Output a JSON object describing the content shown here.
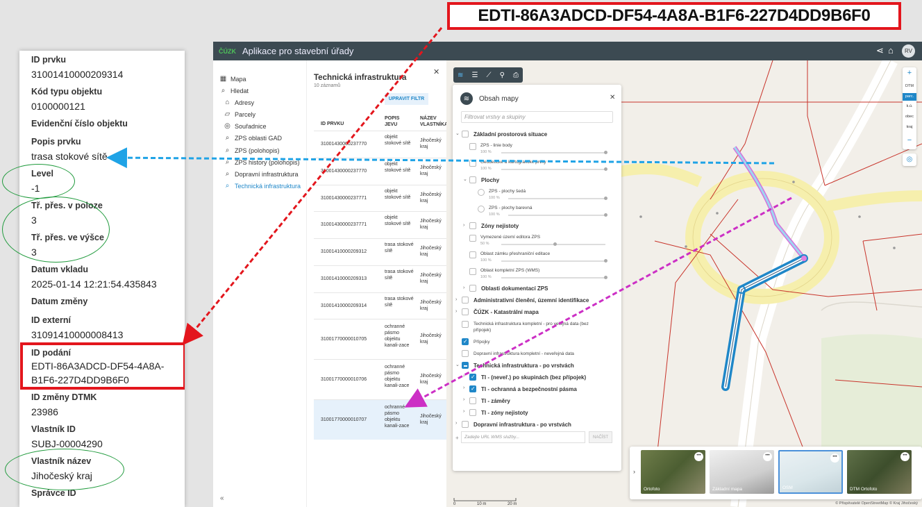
{
  "callout": {
    "id_text": "EDTI-86A3ADCD-DF54-4A8A-B1F6-227D4DD9B6F0"
  },
  "attributes": [
    {
      "label": "ID prvku",
      "value": "31001410000209314"
    },
    {
      "label": "Kód typu objektu",
      "value": "0100000121"
    },
    {
      "label": "Evidenční číslo objektu",
      "value": ""
    },
    {
      "label": "Popis prvku",
      "value": "trasa stokové sítě"
    },
    {
      "label": "Level",
      "value": "-1"
    },
    {
      "label": "Tř. přes. v poloze",
      "value": "3"
    },
    {
      "label": "Tř. přes. ve výšce",
      "value": "3"
    },
    {
      "label": "Datum vkladu",
      "value": "2025-01-14 12:21:54.435843"
    },
    {
      "label": "Datum změny",
      "value": ""
    },
    {
      "label": "ID externí",
      "value": "31091410000008413"
    },
    {
      "label": "ID podání",
      "value": "EDTI-86A3ADCD-DF54-4A8A-B1F6-227D4DD9B6F0"
    },
    {
      "label": "ID změny DTMK",
      "value": "23986"
    },
    {
      "label": "Vlastník ID",
      "value": "SUBJ-00004290"
    },
    {
      "label": "Vlastník název",
      "value": "Jihočeský kraj"
    },
    {
      "label": "Správce ID",
      "value": ""
    }
  ],
  "app": {
    "logo": "ČÚZK",
    "title": "Aplikace pro stavební úřady",
    "icons": {
      "share": "share-icon",
      "home": "home-icon"
    },
    "user_initials": "RV"
  },
  "nav": [
    {
      "label": "Mapa",
      "icon": "map-icon"
    },
    {
      "label": "Hledat",
      "icon": "search-icon"
    },
    {
      "label": "Adresy",
      "icon": "home-icon"
    },
    {
      "label": "Parcely",
      "icon": "parcel-icon"
    },
    {
      "label": "Souřadnice",
      "icon": "target-icon"
    },
    {
      "label": "ZPS oblasti GAD",
      "icon": "search-icon"
    },
    {
      "label": "ZPS (polohopis)",
      "icon": "search-icon"
    },
    {
      "label": "ZPS history (polohopis)",
      "icon": "search-icon"
    },
    {
      "label": "Dopravní infrastruktura",
      "icon": "search-icon"
    },
    {
      "label": "Technická infrastruktura",
      "icon": "search-icon"
    }
  ],
  "results": {
    "title": "Technická infrastruktura",
    "count": "10 záznamů",
    "filter_button": "UPRAVIT FILTR",
    "columns": [
      "ID PRVKU",
      "POPIS JEVU",
      "NÁZEV VLASTNÍKA"
    ],
    "rows": [
      {
        "id": "31001430000237770",
        "popis": "objekt stokové sítě",
        "vlastnik": "Jihočeský kraj"
      },
      {
        "id": "31001430000237770",
        "popis": "objekt stokové sítě",
        "vlastnik": "Jihočeský kraj"
      },
      {
        "id": "31001430000237771",
        "popis": "objekt stokové sítě",
        "vlastnik": "Jihočeský kraj"
      },
      {
        "id": "31001430000237771",
        "popis": "objekt stokové sítě",
        "vlastnik": "Jihočeský kraj"
      },
      {
        "id": "31001410000209312",
        "popis": "trasa stokové sítě",
        "vlastnik": "Jihočeský kraj"
      },
      {
        "id": "31001410000209313",
        "popis": "trasa stokové sítě",
        "vlastnik": "Jihočeský kraj"
      },
      {
        "id": "31001410000209314",
        "popis": "trasa stokové sítě",
        "vlastnik": "Jihočeský kraj"
      },
      {
        "id": "31001770000010705",
        "popis": "ochranné pásmo objektu kanali-zace",
        "vlastnik": "Jihočeský kraj"
      },
      {
        "id": "31001770000010706",
        "popis": "ochranné pásmo objektu kanali-zace",
        "vlastnik": "Jihočeský kraj"
      },
      {
        "id": "31001770000010707",
        "popis": "ochranné pásmo objektu kanali-zace",
        "vlastnik": "Jihočeský kraj"
      }
    ]
  },
  "map_toolbar": [
    "layers-icon",
    "list-icon",
    "ruler-icon",
    "pin-icon",
    "print-icon"
  ],
  "layers_panel": {
    "title": "Obsah mapy",
    "search_placeholder": "Filtrovat vrstvy a skupiny",
    "items": [
      {
        "label": "Základní prostorová situace",
        "pct": ""
      },
      {
        "label": "ZPS - linie body",
        "pct": "100 %"
      },
      {
        "label": "Geodetické a kartografické prvky",
        "pct": "100 %"
      },
      {
        "label": "Plochy",
        "pct": ""
      },
      {
        "label": "ZPS - plochy šedá",
        "pct": "100 %"
      },
      {
        "label": "ZPS - plochy barevná",
        "pct": "100 %"
      },
      {
        "label": "Zóny nejistoty",
        "pct": ""
      },
      {
        "label": "Vymezené území editora ZPS",
        "pct": "50 %"
      },
      {
        "label": "Oblast zámku přeshraniční editace",
        "pct": "100 %"
      },
      {
        "label": "Oblast kompletní ZPS (WMS)",
        "pct": "100 %"
      },
      {
        "label": "Oblasti dokumentací ZPS",
        "pct": ""
      },
      {
        "label": "Administrativní členění, územní identifikace",
        "pct": ""
      },
      {
        "label": "ČÚZK - Katastrální mapa",
        "pct": ""
      },
      {
        "label": "Technická infrastruktura kompletní - pro veřejná data (bez přípojek)",
        "pct": ""
      },
      {
        "label": "Přípojky",
        "pct": ""
      },
      {
        "label": "Dopravní infrastruktura kompletní - neveřejná data",
        "pct": ""
      },
      {
        "label": "Technická infrastruktura - po vrstvách",
        "pct": ""
      },
      {
        "label": "TI - (neveř.) po skupinách (bez přípojek)",
        "pct": ""
      },
      {
        "label": "TI - ochranná a bezpečnostní pásma",
        "pct": ""
      },
      {
        "label": "TI - záměry",
        "pct": ""
      },
      {
        "label": "TI - zóny nejistoty",
        "pct": ""
      },
      {
        "label": "Dopravní infrastruktura - po vrstvách",
        "pct": ""
      }
    ],
    "url_placeholder": "Zadejte URL WMS služby...",
    "load_button": "NAČÍST"
  },
  "zoom": {
    "plus": "+",
    "minus": "−",
    "layers": [
      "DTM",
      "parc.",
      "k.ú.",
      "obec",
      "kraj"
    ]
  },
  "basemaps": [
    {
      "label": "Ortofoto"
    },
    {
      "label": "Základní mapa"
    },
    {
      "label": "OSM"
    },
    {
      "label": "DTM Ortofoto"
    }
  ],
  "scale": {
    "labels": [
      "0",
      "10 m",
      "20 m"
    ]
  },
  "attribution": "© Přispěvatelé OpenStreetMap © Kraj Jihočeský"
}
